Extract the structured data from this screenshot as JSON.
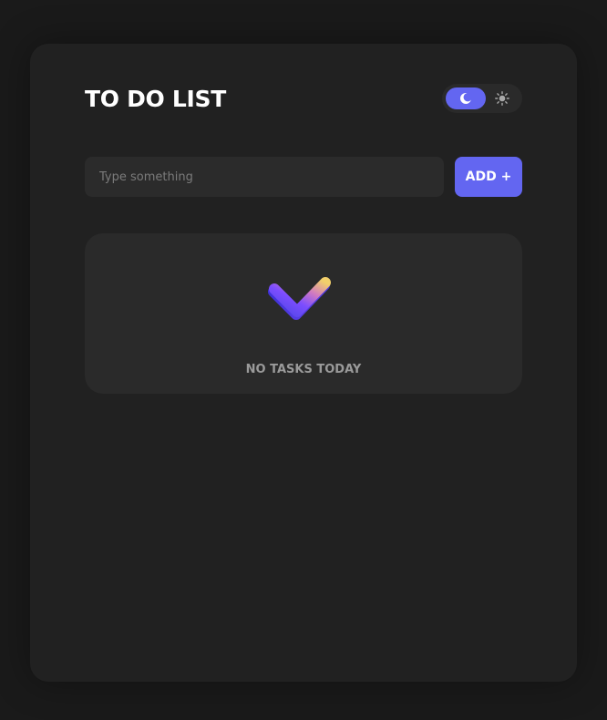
{
  "app": {
    "title": "TO DO LIST"
  },
  "theme_toggle": {
    "active": "dark",
    "options": [
      "dark",
      "light"
    ],
    "accent_color": "#6366f1"
  },
  "input": {
    "value": "",
    "placeholder": "Type something"
  },
  "add_button": {
    "label": "ADD +"
  },
  "empty_state": {
    "message": "NO TASKS TODAY",
    "icon": "checkmark-icon"
  },
  "colors": {
    "background": "#1a1a1a",
    "card": "#212121",
    "panel": "#2a2a2a",
    "accent": "#6366f1"
  }
}
